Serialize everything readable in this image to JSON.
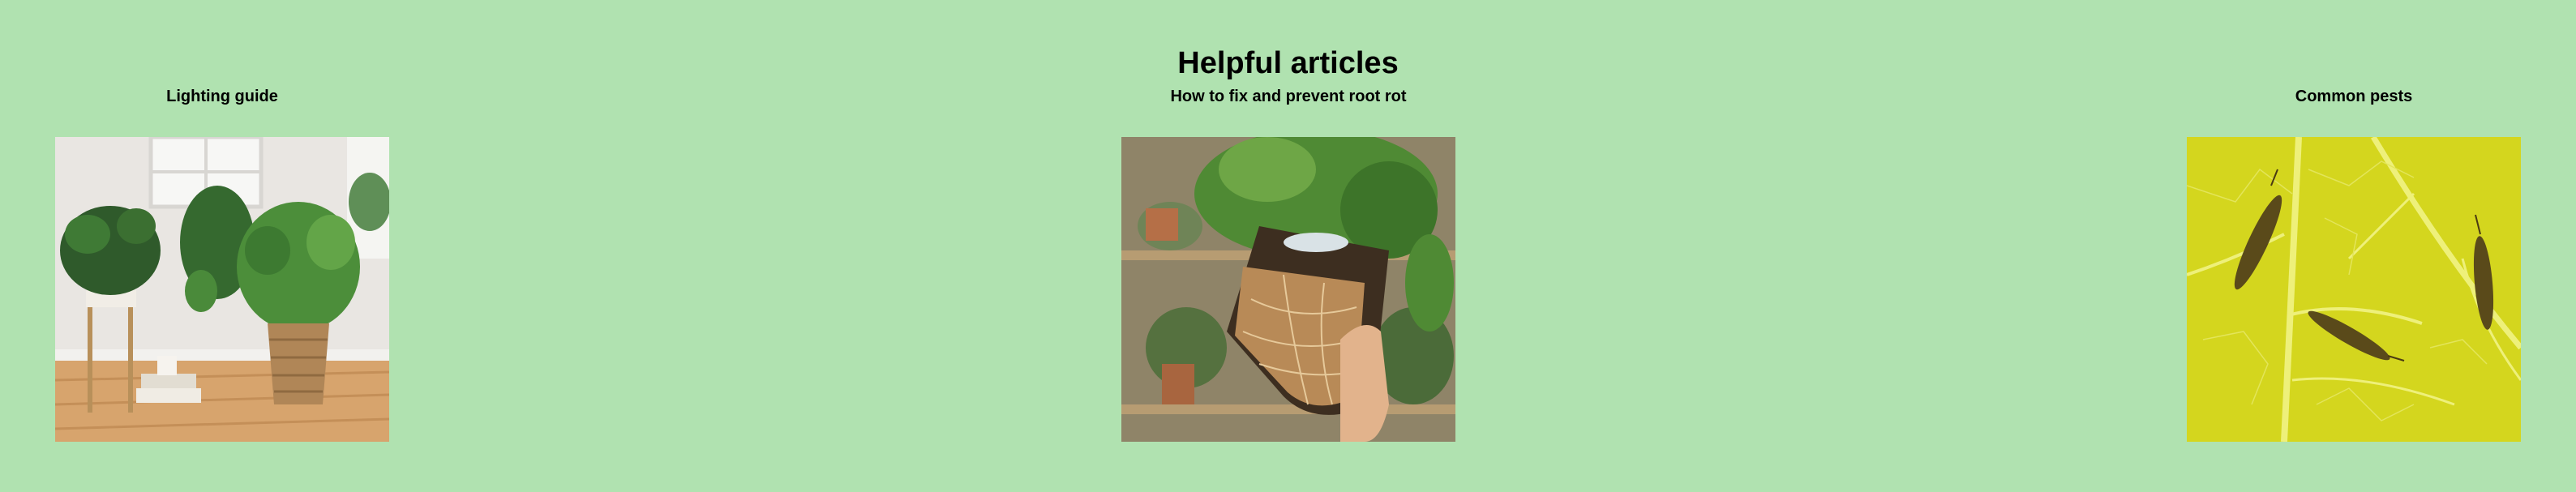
{
  "page": {
    "title": "Helpful articles"
  },
  "articles": [
    {
      "title": "Lighting guide",
      "image_icon": "houseplants-photo"
    },
    {
      "title": "How to fix and prevent root rot",
      "image_icon": "root-ball-photo"
    },
    {
      "title": "Common pests",
      "image_icon": "thrips-on-leaf-photo"
    }
  ],
  "colors": {
    "background": "#b0e2b0",
    "text": "#000000"
  }
}
